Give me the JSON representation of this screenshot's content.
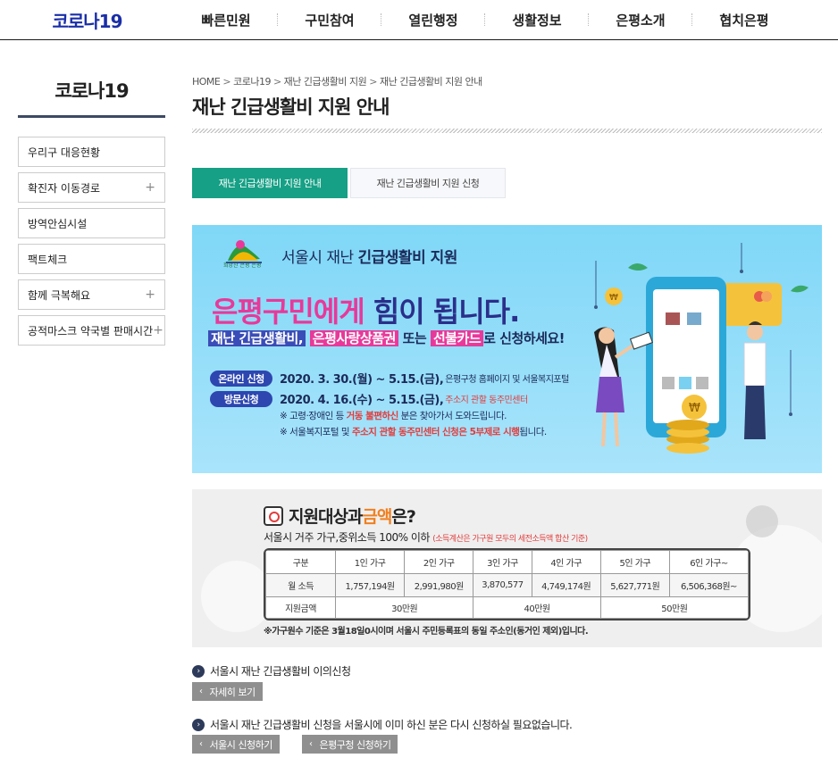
{
  "topnav": {
    "brand": "코로나19",
    "menu": [
      "빠른민원",
      "구민참여",
      "열린행정",
      "생활정보",
      "은평소개",
      "협치은평"
    ]
  },
  "sidebar": {
    "title": "코로나19",
    "items": [
      {
        "label": "우리구 대응현황",
        "expand": ""
      },
      {
        "label": "확진자 이동경로",
        "expand": "+"
      },
      {
        "label": "방역안심시설",
        "expand": ""
      },
      {
        "label": "팩트체크",
        "expand": ""
      },
      {
        "label": "함께 극복해요",
        "expand": "+"
      },
      {
        "label": "공적마스크 약국별 판매시간",
        "expand": "+"
      }
    ]
  },
  "breadcrumb": {
    "items": [
      "HOME",
      "코로나19",
      "재난 긴급생활비 지원",
      "재난 긴급생활비 지원 안내"
    ],
    "sep": ">"
  },
  "page": {
    "title": "재난 긴급생활비 지원 안내"
  },
  "tabs": [
    {
      "label": "재난 긴급생활비 지원 안내",
      "active": true
    },
    {
      "label": "재난 긴급생활비 지원 신청",
      "active": false
    }
  ],
  "banner1": {
    "logo_text": "희망찬 은평 은평",
    "head_pre": "서울시 재난 ",
    "head_bold": "긴급생활비 지원",
    "big_pink": "은평구민에게",
    "big_rest": " 힘이 됩니다.",
    "sub_a": "재난 긴급생활비,",
    "sub_b": "은평사랑상품권",
    "sub_c": "또는",
    "sub_d": "선불카드",
    "sub_e": "로 신청하세요!",
    "online_pill": "온라인 신청",
    "online_date": "2020. 3. 30.(월) ~ 5.15.(금),",
    "online_note": "은평구청 홈페이지 및 서울복지포털",
    "visit_pill": "방문신청",
    "visit_date": "2020. 4. 16.(수) ~ 5.15.(금),",
    "visit_note": "주소지 관할 동주민센터",
    "note1_a": "※ 고령·장애인 등 ",
    "note1_b": "거동 불편하신",
    "note1_c": " 분은 찾아가서 도와드립니다.",
    "note2_a": "※ 서울복지포털 및 ",
    "note2_b": "주소지 관할 동주민센터 신청은 5부제로 시행",
    "note2_c": "됩니다."
  },
  "banner2": {
    "title_a": "지원대상과 ",
    "title_b": "금액",
    "title_c": "은?",
    "subtitle": "서울시 거주 가구,중위소득 100% 이하",
    "subtitle_note": "(소득계산은 가구원 모두의 세전소득액 합산 기준)",
    "headers": [
      "구분",
      "1인 가구",
      "2인 가구",
      "3인 가구",
      "4인 가구",
      "5인 가구",
      "6인 가구~"
    ],
    "income_label": "월 소득",
    "incomes": [
      "1,757,194원",
      "2,991,980원",
      "3,870,577",
      "4,749,174원",
      "5,627,771원",
      "6,506,368원~"
    ],
    "support_label": "지원금액",
    "supports": [
      "30만원",
      "40만원",
      "50만원"
    ],
    "footnote": "※가구원수 기준은 3월18일0시이며 서울시 주민등록표의 동일 주소인(동거인 제외)입니다."
  },
  "links": {
    "appeal_text": "서울시 재난 긴급생활비 이의신청",
    "detail_btn": "자세히 보기",
    "already_text": "서울시 재난 긴급생활비 신청을 서울시에 이미 하신 분은 다시 신청하실 필요없습니다.",
    "seoul_btn": "서울시 신청하기",
    "ep_btn": "은평구청 신청하기",
    "arrow": "‹",
    "bullet": "›"
  },
  "colors": {
    "brand": "#1a2ea8",
    "tab_active": "#16a085",
    "banner_bg": "#8fdcf9",
    "pink": "#e8399a"
  }
}
